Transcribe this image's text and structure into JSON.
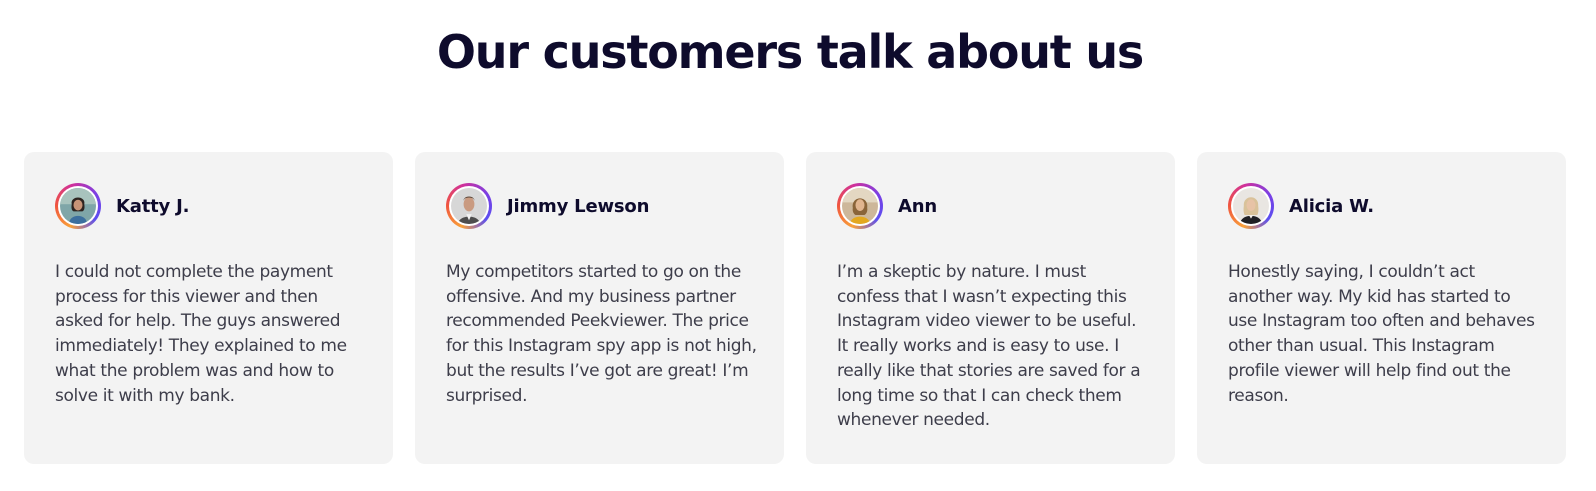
{
  "section": {
    "title": "Our customers talk about us"
  },
  "colors": {
    "card_bg": "#f3f3f3",
    "heading": "#0e0b2c",
    "body_text": "#3d3d4a",
    "avatar_ring_gradient": [
      "#f9a13a",
      "#f0553e",
      "#d0309b",
      "#7b3fe4"
    ]
  },
  "testimonials": [
    {
      "name": "Katty J.",
      "avatar_icon": "user-photo-icon",
      "text": "I could not complete the payment process for this viewer and then asked for help. The guys answered immediately! They explained to me what the problem was and how to solve it with my bank."
    },
    {
      "name": "Jimmy Lewson",
      "avatar_icon": "user-photo-icon",
      "text": "My competitors started to go on the offensive. And my business partner recommended Peekviewer. The price for this Instagram spy app is not high, but the results I’ve got are great! I’m surprised."
    },
    {
      "name": "Ann",
      "avatar_icon": "user-photo-icon",
      "text": "I’m a skeptic by nature. I must confess that I wasn’t expecting this Instagram video viewer to be useful. It really works and is easy to use. I really like that stories are saved for a long time so that I can check them whenever needed."
    },
    {
      "name": "Alicia W.",
      "avatar_icon": "user-photo-icon",
      "text": "Honestly saying, I couldn’t act another way. My kid has started to use Instagram too often and behaves other than usual. This Instagram profile viewer will help find out the reason."
    }
  ]
}
